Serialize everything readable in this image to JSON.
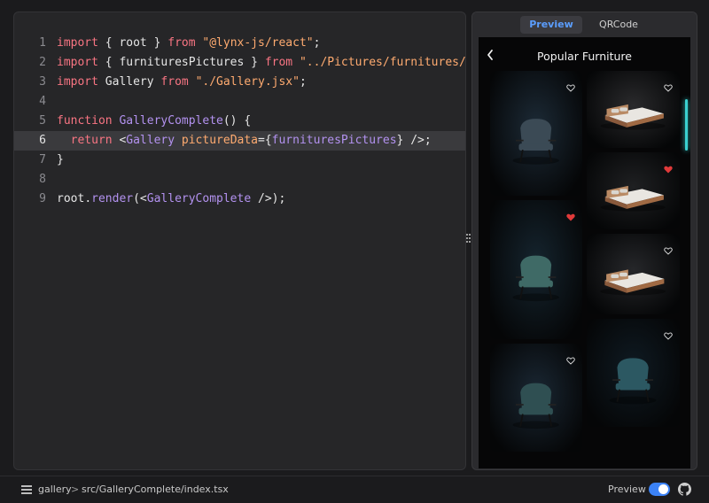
{
  "editor": {
    "lines": [
      {
        "num": "1",
        "tokens": [
          {
            "t": "import",
            "c": "kw"
          },
          {
            "t": " { ",
            "c": "id"
          },
          {
            "t": "root",
            "c": "id"
          },
          {
            "t": " } ",
            "c": "id"
          },
          {
            "t": "from",
            "c": "kw"
          },
          {
            "t": " ",
            "c": "id"
          },
          {
            "t": "\"@lynx-js/react\"",
            "c": "str"
          },
          {
            "t": ";",
            "c": "id"
          }
        ]
      },
      {
        "num": "2",
        "tokens": [
          {
            "t": "import",
            "c": "kw"
          },
          {
            "t": " { ",
            "c": "id"
          },
          {
            "t": "furnituresPictures",
            "c": "id"
          },
          {
            "t": " } ",
            "c": "id"
          },
          {
            "t": "from",
            "c": "kw"
          },
          {
            "t": " ",
            "c": "id"
          },
          {
            "t": "\"../Pictures/furnitures/f",
            "c": "str"
          }
        ]
      },
      {
        "num": "3",
        "tokens": [
          {
            "t": "import",
            "c": "kw"
          },
          {
            "t": " Gallery ",
            "c": "id"
          },
          {
            "t": "from",
            "c": "kw"
          },
          {
            "t": " ",
            "c": "id"
          },
          {
            "t": "\"./Gallery.jsx\"",
            "c": "str"
          },
          {
            "t": ";",
            "c": "id"
          }
        ]
      },
      {
        "num": "4",
        "tokens": []
      },
      {
        "num": "5",
        "tokens": [
          {
            "t": "function",
            "c": "kw"
          },
          {
            "t": " ",
            "c": "id"
          },
          {
            "t": "GalleryComplete",
            "c": "fn"
          },
          {
            "t": "() {",
            "c": "id"
          }
        ]
      },
      {
        "num": "6",
        "active": true,
        "tokens": [
          {
            "t": "  ",
            "c": "id"
          },
          {
            "t": "return",
            "c": "kw"
          },
          {
            "t": " <",
            "c": "id"
          },
          {
            "t": "Gallery",
            "c": "jsx"
          },
          {
            "t": " ",
            "c": "id"
          },
          {
            "t": "pictureData",
            "c": "attr"
          },
          {
            "t": "={",
            "c": "id"
          },
          {
            "t": "furnituresPictures",
            "c": "jsx"
          },
          {
            "t": "} />;",
            "c": "id"
          }
        ]
      },
      {
        "num": "7",
        "tokens": [
          {
            "t": "}",
            "c": "id"
          }
        ]
      },
      {
        "num": "8",
        "tokens": []
      },
      {
        "num": "9",
        "tokens": [
          {
            "t": "root",
            "c": "id"
          },
          {
            "t": ".",
            "c": "id"
          },
          {
            "t": "render",
            "c": "fn"
          },
          {
            "t": "(<",
            "c": "id"
          },
          {
            "t": "GalleryComplete",
            "c": "jsx"
          },
          {
            "t": " />);",
            "c": "id"
          }
        ]
      }
    ]
  },
  "preview": {
    "tabs": [
      {
        "label": "Preview",
        "active": true
      },
      {
        "label": "QRCode",
        "active": false
      }
    ],
    "phone_title": "Popular Furniture",
    "back_icon": "chevron-left-icon",
    "cards": [
      {
        "name": "armchair",
        "liked": false,
        "bg": "#1c2a36"
      },
      {
        "name": "bed",
        "liked": false,
        "bg": "#2a2a2c"
      },
      {
        "name": "bed",
        "liked": true,
        "bg": "#1f2022"
      },
      {
        "name": "armchair",
        "liked": true,
        "bg": "#15242e"
      },
      {
        "name": "bed",
        "liked": false,
        "bg": "#26272a"
      },
      {
        "name": "armchair",
        "liked": false,
        "bg": "#0f1a22"
      },
      {
        "name": "armchair",
        "liked": false,
        "bg": "#1a2733"
      }
    ]
  },
  "statusbar": {
    "list_icon": "list-icon",
    "project": "gallery",
    "separator": ">",
    "path": "src/GalleryComplete/index.tsx",
    "toggle_label": "Preview",
    "toggle_on": true,
    "github_icon": "github-icon"
  },
  "colors": {
    "accent": "#3b82f6",
    "tab_active": "#5b9eff",
    "liked_heart": "#e03a3a",
    "scroll_glow": "#3ad0d0"
  }
}
